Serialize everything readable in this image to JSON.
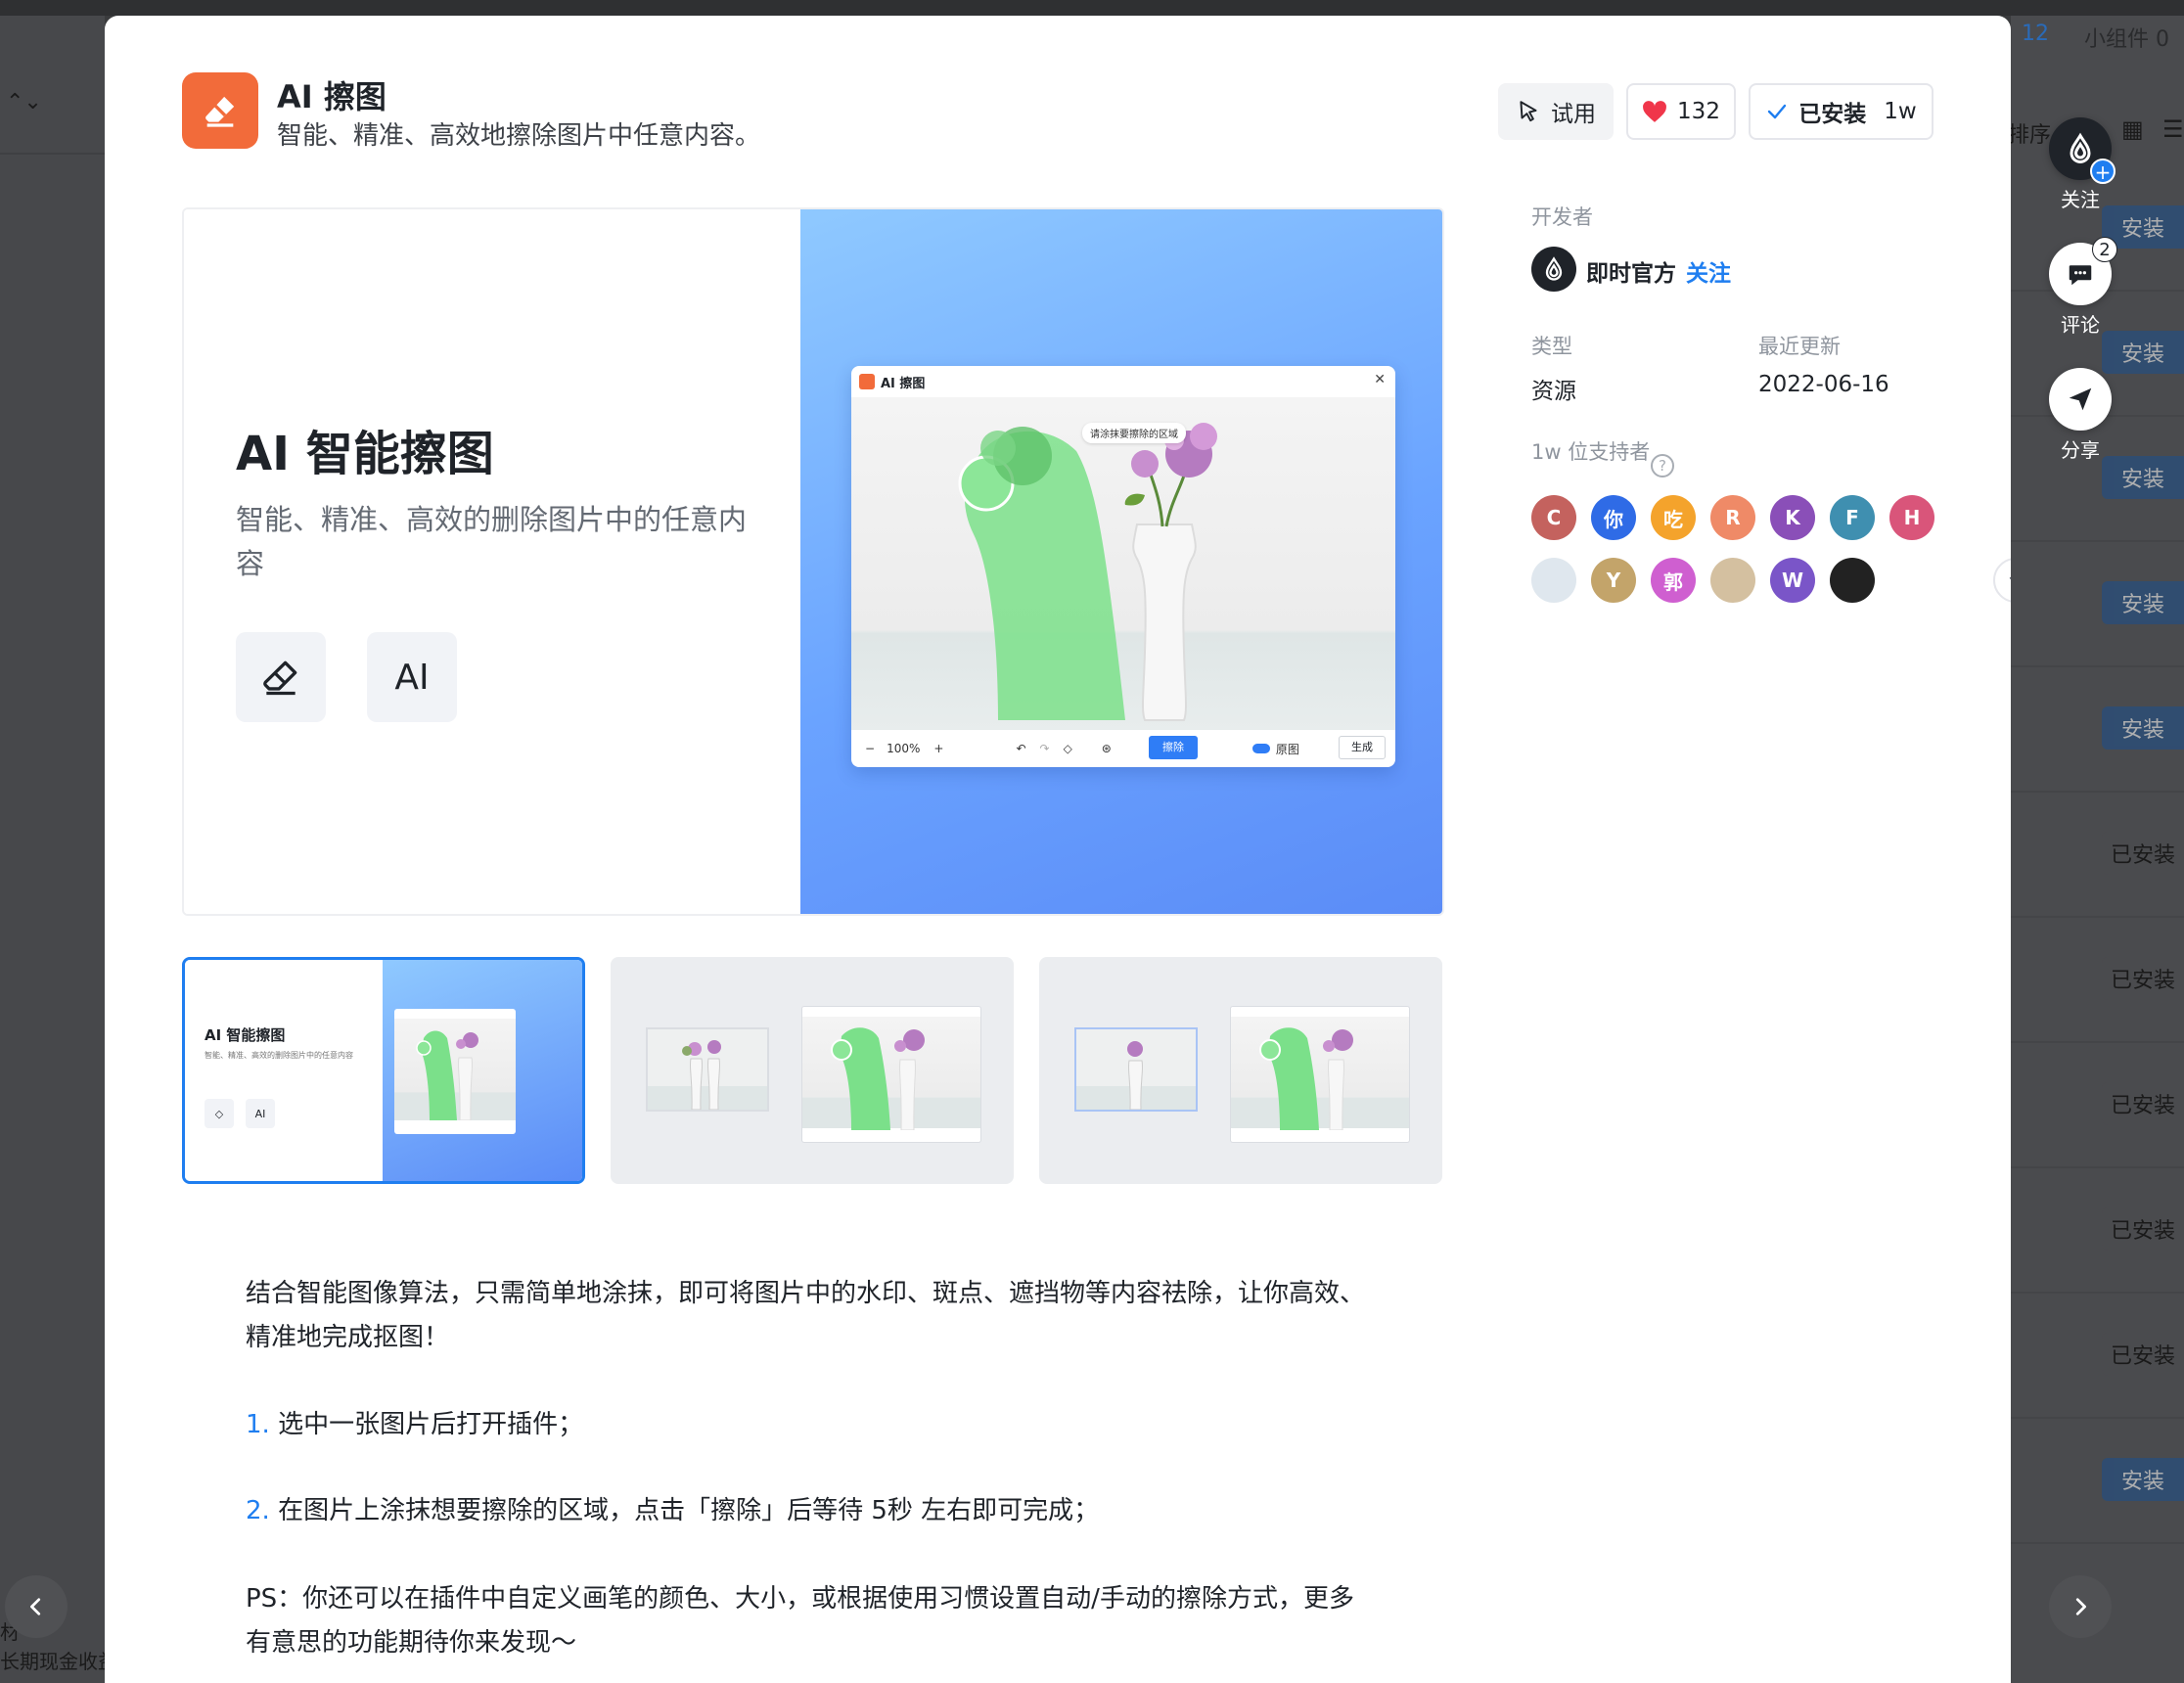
{
  "background": {
    "count_badge": "12",
    "widget_label": "小组件",
    "widget_count": "0",
    "sort_label": "排序",
    "install_labels": [
      "安装",
      "安装",
      "安装",
      "安装",
      "安装",
      "已安装",
      "已安装",
      "已安装",
      "已安装",
      "已安装",
      "安装"
    ],
    "left_bottom_line1": "材",
    "left_bottom_line2": "长期现金收益"
  },
  "floating_actions": {
    "follow_label": "关注",
    "comment_label": "评论",
    "comment_count": "2",
    "share_label": "分享"
  },
  "plugin": {
    "name": "AI 擦图",
    "description": "智能、精准、高效地擦除图片中任意内容。",
    "icon": "eraser-icon",
    "accent_color": "#f26b3a"
  },
  "actions": {
    "try_label": "试用",
    "like_count": "132",
    "installed_label": "已安装",
    "installed_count": "1w"
  },
  "preview": {
    "title": "AI 智能擦图",
    "subtitle": "智能、精准、高效的删除图片中的任意内容",
    "chip_ai": "AI",
    "mock": {
      "window_title": "AI 擦图",
      "tip": "请涂抹要擦除的区域",
      "zoom": "100%",
      "erase_button": "擦除",
      "original_toggle": "原图",
      "generate_button": "生成"
    }
  },
  "thumbnails": [
    {
      "title": "AI 智能擦图",
      "subtitle": "智能、精准、高效的删除图片中的任意内容",
      "chip_ai": "AI"
    },
    {},
    {}
  ],
  "description": {
    "intro": "结合智能图像算法，只需简单地涂抹，即可将图片中的水印、斑点、遮挡物等内容祛除，让你高效、精准地完成抠图！",
    "step1_num": "1.",
    "step1": "选中一张图片后打开插件；",
    "step2_num": "2.",
    "step2": "在图片上涂抹想要擦除的区域，点击「擦除」后等待 5秒 左右即可完成；",
    "ps": "PS：你还可以在插件中自定义画笔的颜色、大小，或根据使用习惯设置自动/手动的擦除方式，更多有意思的功能期待你来发现～"
  },
  "sidebar": {
    "developer_label": "开发者",
    "developer_name": "即时官方",
    "follow_label": "关注",
    "type_label": "类型",
    "type_value": "资源",
    "updated_label": "最近更新",
    "updated_value": "2022-06-16",
    "supporters_label": "1w 位支持者",
    "supporters_row1": [
      {
        "text": "C",
        "color": "#c4625e"
      },
      {
        "text": "你",
        "color": "#2f6be6"
      },
      {
        "text": "吃",
        "color": "#f4a32c"
      },
      {
        "text": "R",
        "color": "#ef8a67"
      },
      {
        "text": "K",
        "color": "#8a4fb8"
      },
      {
        "text": "F",
        "color": "#3f8fb0"
      },
      {
        "text": "H",
        "color": "#d9557a"
      }
    ],
    "supporters_row2": [
      {
        "text": "",
        "color": "#dfe7ee"
      },
      {
        "text": "Y",
        "color": "#c3a46a"
      },
      {
        "text": "郭",
        "color": "#cf5fd0"
      },
      {
        "text": "",
        "color": "#d4c0a0"
      },
      {
        "text": "W",
        "color": "#7a55c8"
      },
      {
        "text": "",
        "color": "#222222"
      }
    ]
  }
}
